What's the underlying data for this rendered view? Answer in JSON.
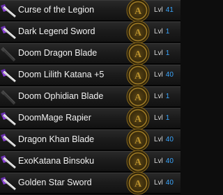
{
  "level_label": "Lvl",
  "colors": {
    "level_value": "#3aa7ff",
    "icon_purple": "#8a3fd6",
    "row_bg": "#1c1c1c",
    "emblem_gold": "#b8902e"
  },
  "items": [
    {
      "name": "Curse of the Legion",
      "level": "41",
      "icon": "sword-purple-icon"
    },
    {
      "name": "Dark Legend Sword",
      "level": "1",
      "icon": "sword-purple-icon"
    },
    {
      "name": "Doom Dragon Blade",
      "level": "1",
      "icon": "sword-dark-icon"
    },
    {
      "name": "Doom Lilith Katana +5",
      "level": "40",
      "icon": "sword-purple-icon"
    },
    {
      "name": "Doom Ophidian Blade",
      "level": "1",
      "icon": "sword-dark-icon"
    },
    {
      "name": "DoomMage Rapier",
      "level": "1",
      "icon": "sword-purple-icon"
    },
    {
      "name": "Dragon Khan Blade",
      "level": "40",
      "icon": "sword-purple-icon"
    },
    {
      "name": "ExoKatana Binsoku",
      "level": "40",
      "icon": "sword-purple-icon"
    },
    {
      "name": "Golden Star Sword",
      "level": "40",
      "icon": "sword-purple-icon"
    }
  ]
}
